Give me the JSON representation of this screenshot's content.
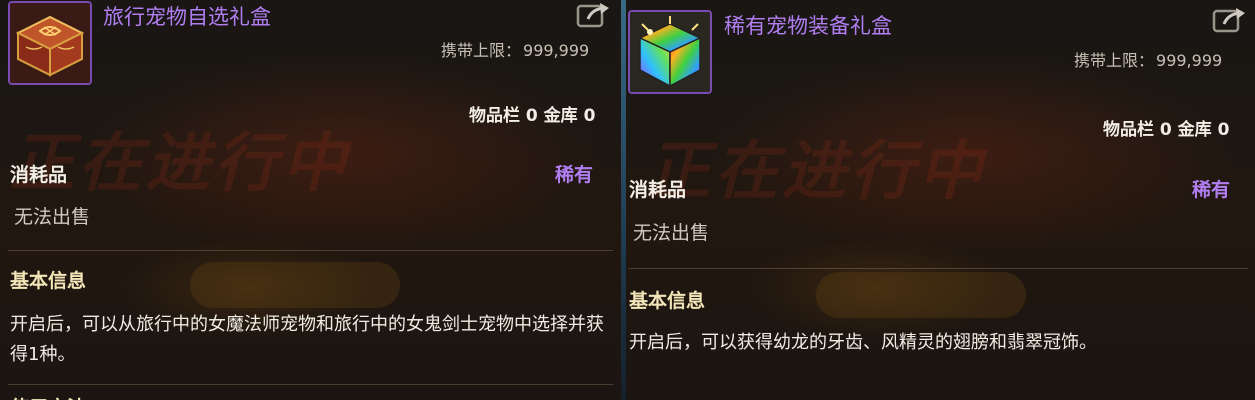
{
  "left": {
    "item_name": "旅行宠物自选礼盒",
    "carry_limit_label": "携带上限：",
    "carry_limit_value": "999,999",
    "storage": "物品栏 0 金库 0",
    "category": "消耗品",
    "rarity": "稀有",
    "sell_status": "无法出售",
    "section_title": "基本信息",
    "description": "开启后，可以从旅行中的女魔法师宠物和旅行中的女鬼剑士宠物中选择并获得1种。",
    "icon": "red-gold-treasure-box-icon"
  },
  "right": {
    "item_name": "稀有宠物装备礼盒",
    "carry_limit_label": "携带上限：",
    "carry_limit_value": "999,999",
    "storage": "物品栏 0 金库 0",
    "category": "消耗品",
    "rarity": "稀有",
    "sell_status": "无法出售",
    "section_title": "基本信息",
    "description": "开启后，可以获得幼龙的牙齿、风精灵的翅膀和翡翠冠饰。",
    "icon": "rainbow-cube-box-icon"
  },
  "colors": {
    "rarity_purple": "#b07ef0",
    "title_gold": "#f2e6b8",
    "text": "#f0ece4"
  }
}
